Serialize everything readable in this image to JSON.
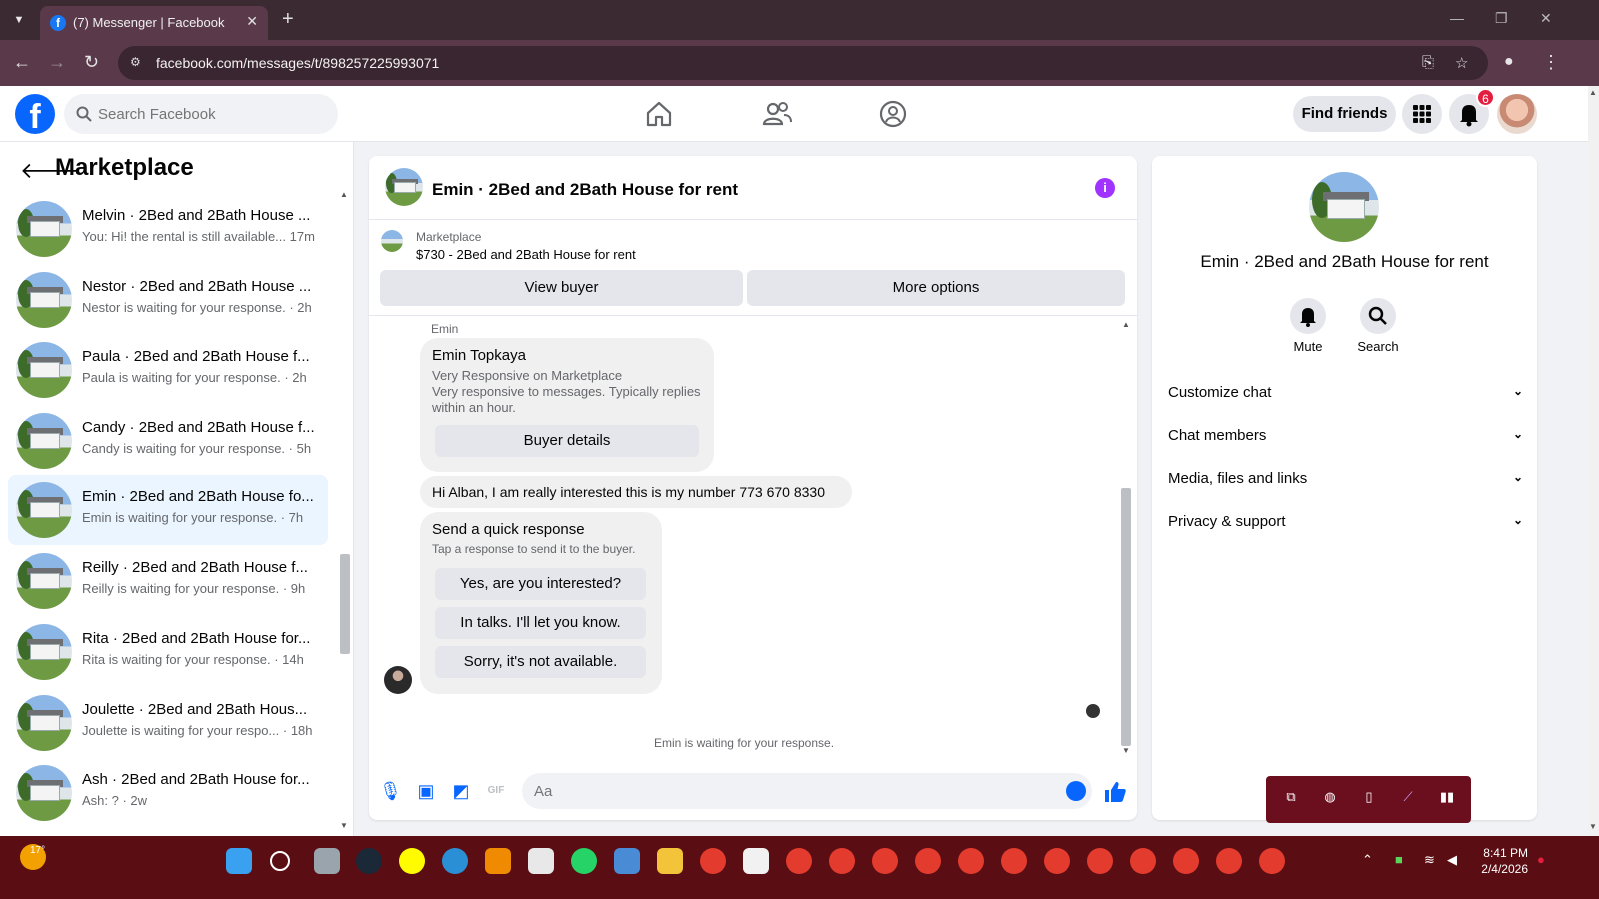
{
  "browser": {
    "tab_title": "(7) Messenger | Facebook",
    "url": "facebook.com/messages/t/898257225993071"
  },
  "header": {
    "search_placeholder": "Search Facebook",
    "find_friends": "Find friends",
    "notification_count": "6"
  },
  "sidebar": {
    "title": "Marketplace",
    "conversations": [
      {
        "name": "Melvin · 2Bed and 2Bath House ...",
        "preview": "You: Hi! the rental is still available... 17m"
      },
      {
        "name": "Nestor · 2Bed and 2Bath House ...",
        "preview": "Nestor is waiting for your response. · 2h"
      },
      {
        "name": "Paula · 2Bed and 2Bath House f...",
        "preview": "Paula is waiting for your response. · 2h"
      },
      {
        "name": "Candy · 2Bed and 2Bath House f...",
        "preview": "Candy is waiting for your response. · 5h"
      },
      {
        "name": "Emin · 2Bed and 2Bath House fo...",
        "preview": "Emin is waiting for your response. · 7h"
      },
      {
        "name": "Reilly · 2Bed and 2Bath House f...",
        "preview": "Reilly is waiting for your response. · 9h"
      },
      {
        "name": "Rita · 2Bed and 2Bath House for...",
        "preview": "Rita is waiting for your response. · 14h"
      },
      {
        "name": "Joulette · 2Bed and 2Bath Hous...",
        "preview": "Joulette is waiting for your respo... · 18h"
      },
      {
        "name": "Ash · 2Bed and 2Bath House for...",
        "preview": "Ash: ? · 2w"
      }
    ]
  },
  "chat": {
    "title": "Emin · 2Bed and 2Bath House for rent",
    "marketplace_label": "Marketplace",
    "listing": "$730 - 2Bed and 2Bath House for rent",
    "view_buyer": "View buyer",
    "more_options": "More options",
    "sender_label": "Emin",
    "profile_card": {
      "name": "Emin Topkaya",
      "line1": "Very Responsive on Marketplace",
      "line2": "Very responsive to messages. Typically replies within an hour.",
      "button": "Buyer details"
    },
    "message": "Hi Alban, I am really interested this is my number 773 670 8330",
    "quick_response": {
      "title": "Send a quick response",
      "subtitle": "Tap a response to send it to the buyer.",
      "options": [
        "Yes, are you interested?",
        "In talks. I'll let you know.",
        "Sorry, it's not available."
      ]
    },
    "waiting_note": "Emin is waiting for your response.",
    "composer_placeholder": "Aa"
  },
  "right_panel": {
    "title": "Emin · 2Bed and 2Bath House for rent",
    "mute": "Mute",
    "search": "Search",
    "sections": [
      "Customize chat",
      "Chat members",
      "Media, files and links",
      "Privacy & support"
    ]
  },
  "taskbar": {
    "temperature": "17°",
    "time": "8:41 PM",
    "date": "2/4/2026"
  },
  "colors": {
    "brand": "#0866ff",
    "info": "#a033ff",
    "taskbar": "#5a0e13"
  }
}
